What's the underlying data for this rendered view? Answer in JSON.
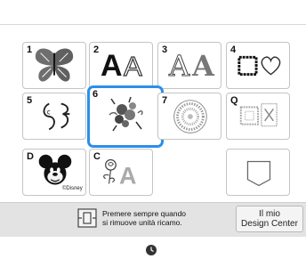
{
  "tiles": [
    {
      "number": "1",
      "icon": "butterfly-icon"
    },
    {
      "number": "2",
      "icon": "font-a-icon"
    },
    {
      "number": "3",
      "icon": "decorative-font-icon"
    },
    {
      "number": "4",
      "icon": "frame-heart-icon"
    },
    {
      "number": "5",
      "icon": "flourish-icon"
    },
    {
      "number": "6",
      "icon": "floral-bouquet-icon",
      "selected": true
    },
    {
      "number": "7",
      "icon": "mandala-icon"
    },
    {
      "number": "Q",
      "icon": "quilt-pattern-icon"
    },
    {
      "number": "D",
      "icon": "mickey-icon",
      "caption": "©Disney"
    },
    {
      "number": "C",
      "icon": "rose-letter-icon"
    },
    {
      "number": "",
      "icon": "pocket-icon"
    }
  ],
  "hint": {
    "line1": "Premere sempre quando",
    "line2": "si rimuove unità ricamo.",
    "icon": "embroidery-unit-icon"
  },
  "design_center_button": {
    "line1": "Il mio",
    "line2": "Design Center"
  },
  "status": {
    "icon": "clock-icon"
  },
  "colors": {
    "selected_border": "#2b8fe8",
    "bar_background": "#e3e3e3"
  }
}
